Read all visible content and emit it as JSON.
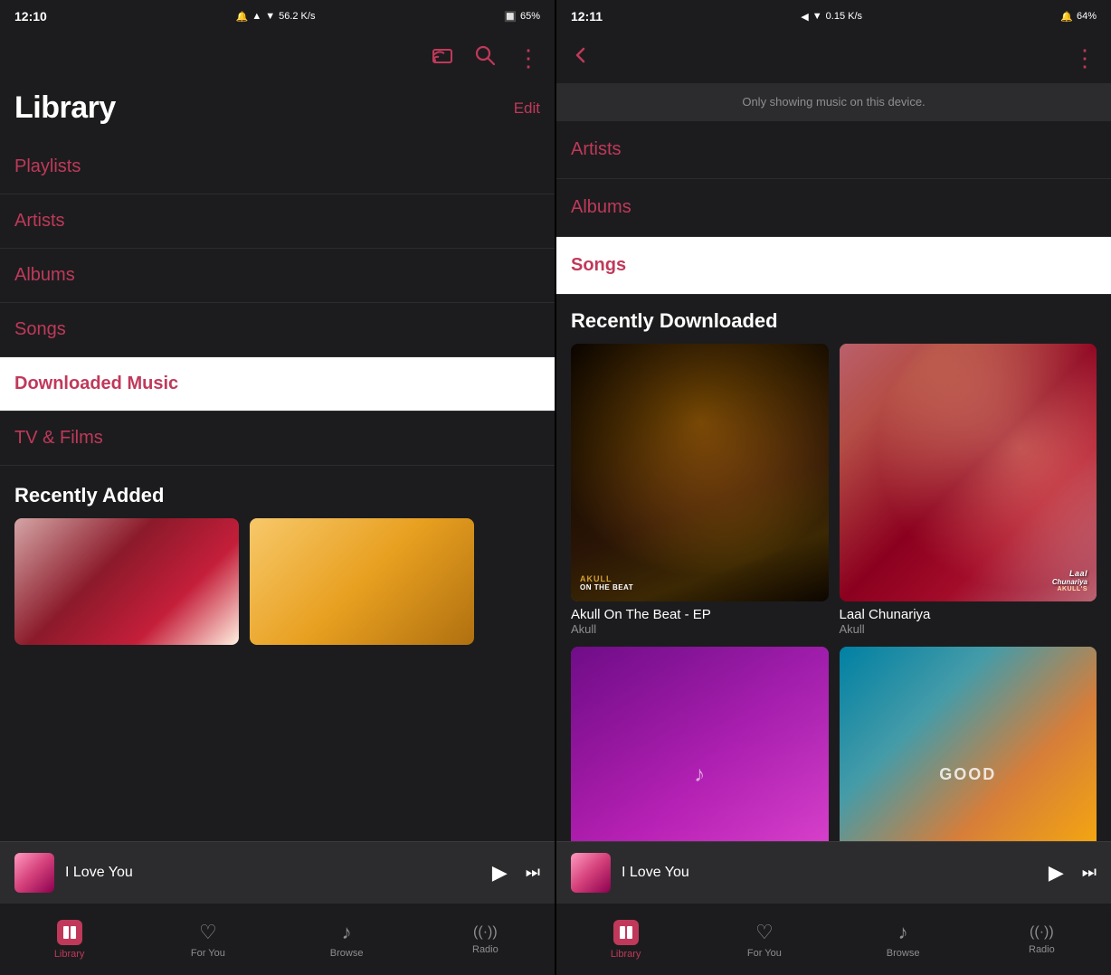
{
  "left": {
    "statusBar": {
      "time": "12:10",
      "speed": "56.2 K/s",
      "battery": "65%"
    },
    "pageTitle": "Library",
    "editBtn": "Edit",
    "menuItems": [
      {
        "label": "Playlists",
        "active": false
      },
      {
        "label": "Artists",
        "active": false
      },
      {
        "label": "Albums",
        "active": false
      },
      {
        "label": "Songs",
        "active": false
      },
      {
        "label": "Downloaded Music",
        "active": true
      },
      {
        "label": "TV & Films",
        "active": false
      }
    ],
    "recentlyAdded": {
      "title": "Recently Added"
    },
    "miniPlayer": {
      "title": "I Love You"
    },
    "bottomNav": [
      {
        "label": "Library",
        "active": true
      },
      {
        "label": "For You",
        "active": false
      },
      {
        "label": "Browse",
        "active": false
      },
      {
        "label": "Radio",
        "active": false
      }
    ]
  },
  "right": {
    "statusBar": {
      "time": "12:11",
      "speed": "0.15 K/s",
      "battery": "64%"
    },
    "deviceNotice": "Only showing music on this device.",
    "menuItems": [
      {
        "label": "Artists",
        "active": false
      },
      {
        "label": "Albums",
        "active": false
      },
      {
        "label": "Songs",
        "active": true
      }
    ],
    "recentlyDownloaded": {
      "title": "Recently Downloaded",
      "items": [
        {
          "title": "Akull On The Beat - EP",
          "artist": "Akull"
        },
        {
          "title": "Laal Chunariya",
          "artist": "Akull"
        },
        {
          "title": "",
          "artist": ""
        },
        {
          "title": "",
          "artist": ""
        }
      ]
    },
    "miniPlayer": {
      "title": "I Love You"
    },
    "bottomNav": [
      {
        "label": "Library",
        "active": true
      },
      {
        "label": "For You",
        "active": false
      },
      {
        "label": "Browse",
        "active": false
      },
      {
        "label": "Radio",
        "active": false
      }
    ]
  },
  "icons": {
    "cast": "⇱",
    "search": "⌕",
    "more": "⋮",
    "back": "←",
    "play": "▶",
    "skipForward": "⏭",
    "library": "♪",
    "heart": "♡",
    "music": "♪",
    "radio": "((·))"
  }
}
